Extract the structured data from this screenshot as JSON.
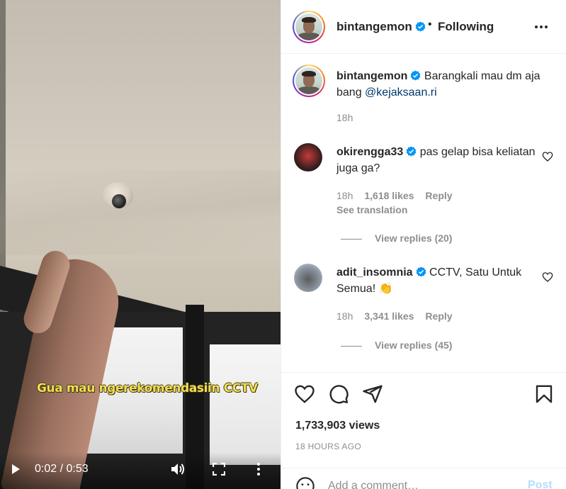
{
  "video": {
    "subtitle": "Gua mau ngerekomendasiin CCTV",
    "time_display": "0:02 / 0:53",
    "icons": {
      "play": "play-icon",
      "volume": "volume-icon",
      "fullscreen": "fullscreen-icon",
      "more": "more-vertical-icon"
    }
  },
  "header": {
    "username": "bintangemon",
    "verified": true,
    "separator": "•",
    "follow_state": "Following",
    "more_icon": "more-horizontal-icon"
  },
  "caption": {
    "username": "bintangemon",
    "text": "Barangkali mau dm aja bang",
    "mention": "@kejaksaan.ri",
    "time": "18h"
  },
  "comments": [
    {
      "username": "okirengga33",
      "verified": true,
      "text": "pas gelap bisa keliatan juga ga?",
      "time": "18h",
      "likes": "1,618 likes",
      "reply": "Reply",
      "see_translation": "See translation",
      "view_replies": "View replies (20)"
    },
    {
      "username": "adit_insomnia",
      "verified": true,
      "text": "CCTV, Satu Untuk Semua!",
      "emoji": "👏",
      "time": "18h",
      "likes": "3,341 likes",
      "reply": "Reply",
      "view_replies": "View replies (45)"
    }
  ],
  "actions": {
    "views": "1,733,903 views",
    "posted": "18 HOURS AGO",
    "icons": [
      "heart-icon",
      "comment-icon",
      "share-icon",
      "bookmark-icon"
    ]
  },
  "add_comment": {
    "placeholder": "Add a comment…",
    "post_label": "Post"
  },
  "colors": {
    "verified_blue": "#0095f6",
    "link": "#00376b",
    "secondary_text": "#8e8e8e",
    "post_disabled": "#b2dffc",
    "subtitle_yellow": "#f3df52"
  }
}
